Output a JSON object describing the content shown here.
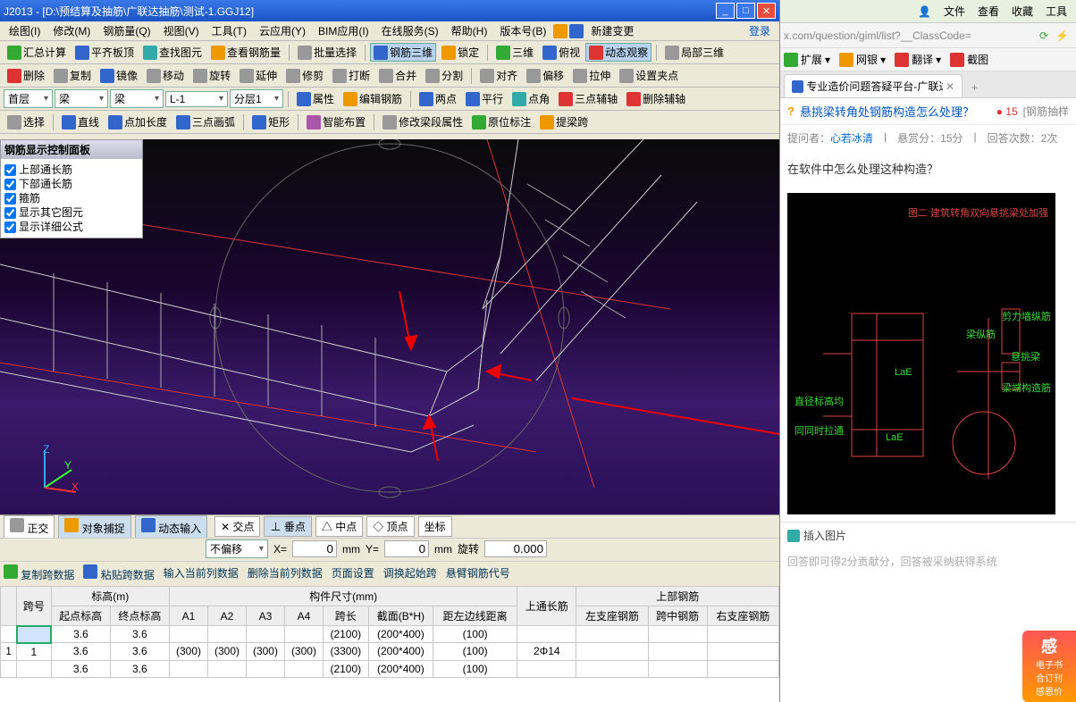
{
  "app": {
    "title": "J2013 - [D:\\预结算及抽筋\\广联达抽筋\\测试-1.GGJ12]",
    "menus": [
      "绘图(I)",
      "修改(M)",
      "钢筋量(Q)",
      "视图(V)",
      "工具(T)",
      "云应用(Y)",
      "BIM应用(I)",
      "在线服务(S)",
      "帮助(H)",
      "版本号(B)",
      "新建变更"
    ],
    "login": "登录",
    "tb1": {
      "huizong": "汇总计算",
      "pingqi": "平齐板顶",
      "chazhao": "查找图元",
      "chakan": "查看钢筋量",
      "piliang": "批量选择",
      "sanwei": "钢筋三维",
      "suoding": "锁定",
      "sanwei2": "三维",
      "fushi": "俯视",
      "dongtai": "动态观察",
      "jubu": "局部三维"
    },
    "tb2": {
      "shanchu": "删除",
      "fuzhi": "复制",
      "jingxiang": "镜像",
      "yidong": "移动",
      "xuanzhuan": "旋转",
      "yanshen": "延伸",
      "xiujian": "修剪",
      "daduan": "打断",
      "hebing": "合并",
      "fenge": "分割",
      "duiqi": "对齐",
      "pianyi": "偏移",
      "lashen": "拉伸",
      "shezhi": "设置夹点"
    },
    "tb3": {
      "floor": "首层",
      "comp1": "梁",
      "comp2": "梁",
      "comp3": "L-1",
      "layer": "分层1",
      "shuxing": "属性",
      "bianji": "编辑钢筋",
      "liangdian": "两点",
      "pingxing": "平行",
      "dianjiao": "点角",
      "sandian": "三点辅轴",
      "shanchufu": "删除辅轴"
    },
    "tb4": {
      "xuanze": "选择",
      "zhixian": "直线",
      "dianjia": "点加长度",
      "sandianhu": "三点画弧",
      "juxing": "矩形",
      "zhineng": "智能布置",
      "xiugai": "修改梁段属性",
      "yuanwei": "原位标注",
      "tiliang": "提梁跨"
    },
    "panel": {
      "title": "钢筋显示控制面板",
      "opt1": "上部通长筋",
      "opt2": "下部通长筋",
      "opt3": "箍筋",
      "opt4": "显示其它图元",
      "opt5": "显示详细公式"
    },
    "status": {
      "zhengjiao": "正交",
      "duixiang": "对象捕捉",
      "dongtai": "动态输入",
      "jiaodian": "交点",
      "chuidian": "垂点",
      "zhongdian": "中点",
      "dingdian": "顶点",
      "zuobiao": "坐标"
    },
    "offset": {
      "mode": "不偏移",
      "x": "0",
      "y": "0",
      "unit": "mm",
      "rot": "旋转",
      "rotval": "0.000"
    },
    "databar": {
      "copy": "复制跨数据",
      "paste": "粘贴跨数据",
      "input": "输入当前列数据",
      "del": "删除当前列数据",
      "page": "页面设置",
      "adjust": "调换起始跨",
      "cant": "悬臂钢筋代号"
    },
    "table": {
      "headers": {
        "kuahao": "跨号",
        "biaogao": "标高(m)",
        "qidian": "起点标高",
        "zhongdian": "终点标高",
        "goujian": "构件尺寸(mm)",
        "a1": "A1",
        "a2": "A2",
        "a3": "A3",
        "a4": "A4",
        "kuachang": "跨长",
        "jiemian": "截面(B*H)",
        "juzuo": "距左边线距离",
        "shangtong": "上通长筋",
        "shangbu": "上部钢筋",
        "zuozhi": "左支座钢筋",
        "kuazhong": "跨中钢筋",
        "youzhi": "右支座钢筋"
      },
      "rows": [
        {
          "idx": "",
          "no": "",
          "qd": "3.6",
          "zd": "3.6",
          "a1": "",
          "a2": "",
          "a3": "",
          "a4": "",
          "kc": "(2100)",
          "jm": "(200*400)",
          "jz": "(100)",
          "st": "",
          "zz": "",
          "kzj": "",
          "yz": ""
        },
        {
          "idx": "1",
          "no": "1",
          "qd": "3.6",
          "zd": "3.6",
          "a1": "(300)",
          "a2": "(300)",
          "a3": "(300)",
          "a4": "(300)",
          "kc": "(3300)",
          "jm": "(200*400)",
          "jz": "(100)",
          "st": "2Φ14",
          "zz": "",
          "kzj": "",
          "yz": ""
        },
        {
          "idx": "",
          "no": "",
          "qd": "3.6",
          "zd": "3.6",
          "a1": "",
          "a2": "",
          "a3": "",
          "a4": "",
          "kc": "(2100)",
          "jm": "(200*400)",
          "jz": "(100)",
          "st": "",
          "zz": "",
          "kzj": "",
          "yz": ""
        }
      ]
    }
  },
  "browser": {
    "topmenu": {
      "file": "文件",
      "view": "查看",
      "fav": "收藏",
      "tool": "工具"
    },
    "url": "x.com/question/giml/list?__ClassCode=",
    "ext": {
      "kuozhan": "扩展",
      "wangyin": "网银",
      "fanyi": "翻译",
      "jietu": "截图"
    },
    "tab": {
      "title": "专业造价问题答疑平台-广联达",
      "favicon": "gear-icon"
    },
    "question": {
      "title": "悬挑梁转角处钢筋构造怎么处理？",
      "bounty": "15",
      "tags": "[钢筋抽样",
      "asker_lbl": "提问者：",
      "asker": "心若冰清",
      "bonus_lbl": "悬赏分：",
      "bonus": "15分",
      "ans_lbl": "回答次数：",
      "ans": "2次",
      "body": "在软件中怎么处理这种构造？",
      "diag_title": "图二 建筑转角双向悬挑梁处加强",
      "diag_l1": "梁纵筋",
      "diag_l2": "剪力墙纵筋",
      "diag_l3": "悬挑梁",
      "diag_l4": "梁端构造筋",
      "diag_l5": "直径标高均",
      "diag_l6": "同同时拉通",
      "diag_l7": "LaE",
      "diag_l8": "LaE"
    },
    "insert": "插入图片",
    "hint": "回答即可得2分贡献分，回答被采纳获得系统",
    "promo": {
      "l1": "感",
      "l2": "电子书",
      "l3": "合订刊",
      "l4": "感恩价"
    }
  }
}
